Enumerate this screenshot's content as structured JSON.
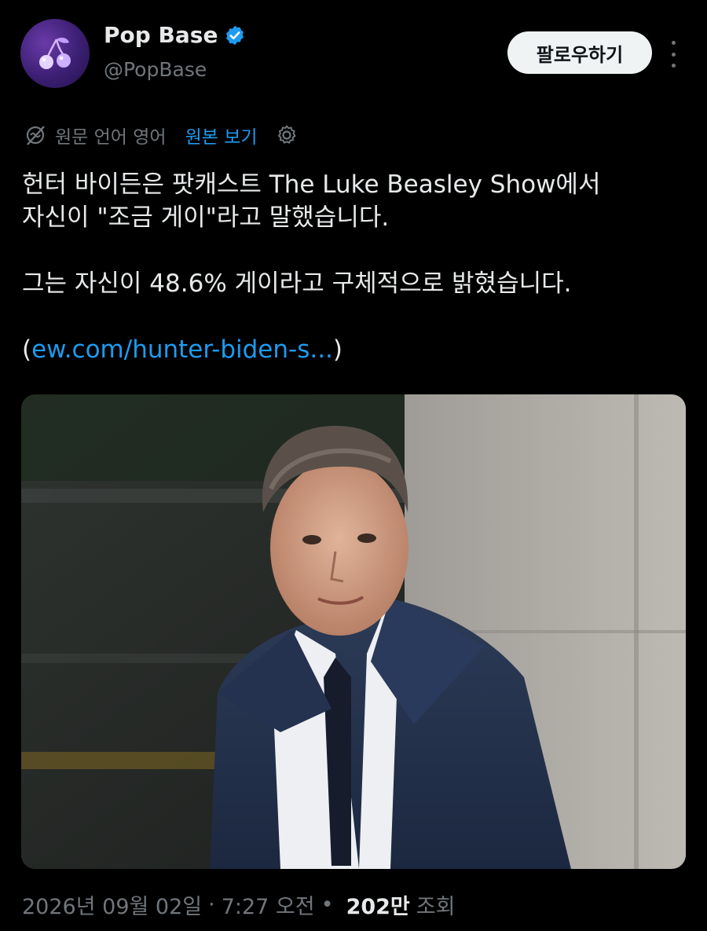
{
  "author": {
    "name": "Pop Base",
    "handle": "@PopBase",
    "verified": true,
    "avatar_icon": "cherry-icon"
  },
  "actions": {
    "follow_label": "팔로우하기",
    "more_icon": "more-vertical-icon"
  },
  "translation": {
    "source_language": "원문 언어 영어",
    "show_original": "원본 보기",
    "settings_icon": "gear-icon"
  },
  "tweet": {
    "line1": "헌터 바이든은 팟캐스트 The Luke Beasley Show에서",
    "line2": "자신이 \"조금 게이\"라고 말했습니다.",
    "line3": "그는 자신이 48.6% 게이라고 구체적으로 밝혔습니다.",
    "link_open": "(",
    "link_text": "ew.com/hunter-biden-s...",
    "link_close": ")"
  },
  "media": {
    "image_name": "hunter-biden-photo"
  },
  "meta": {
    "date": "2026년 09월 02일",
    "separator": "·",
    "time": "7:27 오전",
    "separator2": "•",
    "views_count": "202만",
    "views_label": "조회"
  },
  "colors": {
    "background": "#000000",
    "text": "#e7e9ea",
    "muted": "#71767b",
    "link": "#1d9bf0",
    "follow_bg": "#eff3f4"
  }
}
